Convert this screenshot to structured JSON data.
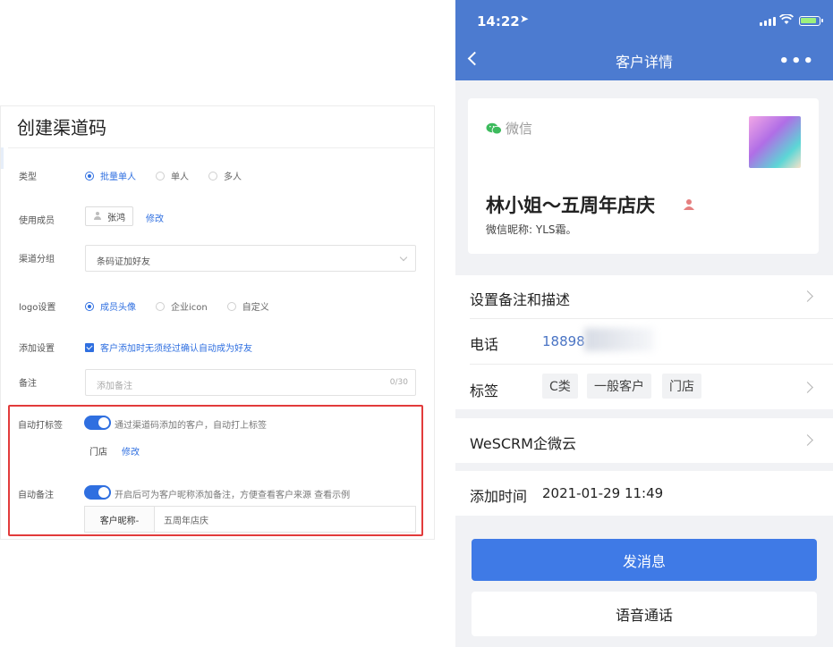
{
  "form": {
    "title": "创建渠道码",
    "type": {
      "label": "类型",
      "options": [
        "批量单人",
        "单人",
        "多人"
      ]
    },
    "members": {
      "label": "使用成员",
      "member_name": "张鸿",
      "edit_link": "修改"
    },
    "group": {
      "label": "渠道分组",
      "value": "条码证加好友"
    },
    "logo": {
      "label": "logo设置",
      "options": [
        "成员头像",
        "企业icon",
        "自定义"
      ]
    },
    "add_setting": {
      "label": "添加设置",
      "checkbox_text": "客户添加时无须经过确认自动成为好友"
    },
    "note": {
      "label": "备注",
      "placeholder": "添加备注",
      "counter": "0/30"
    },
    "auto_tag": {
      "label": "自动打标签",
      "switch_text": "通过渠道码添加的客户，自动打上标签",
      "tag": "门店",
      "edit_link": "修改"
    },
    "auto_remark": {
      "label": "自动备注",
      "switch_text": "开启后可为客户昵称添加备注，方便查看客户来源 查看示例",
      "key": "客户昵称-",
      "value": "五周年店庆"
    }
  },
  "phone": {
    "status": {
      "time": "14:22",
      "location_glyph": "➤"
    },
    "nav": {
      "title": "客户详情",
      "more": "•••"
    },
    "profile": {
      "source": "微信",
      "name": "林小姐～五周年店庆",
      "nickname": "微信昵称: YLS霜。"
    },
    "rows": {
      "remark": "设置备注和描述",
      "phone_label": "电话",
      "phone_value": "18898",
      "tags_label": "标签",
      "tags": [
        "C类",
        "一般客户",
        "门店"
      ],
      "company": "WeSCRM企微云",
      "added_label": "添加时间",
      "added_value": "2021-01-29 11:49"
    },
    "buttons": {
      "send": "发消息",
      "call": "语音通话"
    },
    "colors": {
      "header": "#4c7bd0",
      "primary_button": "#3f7ae6"
    }
  }
}
